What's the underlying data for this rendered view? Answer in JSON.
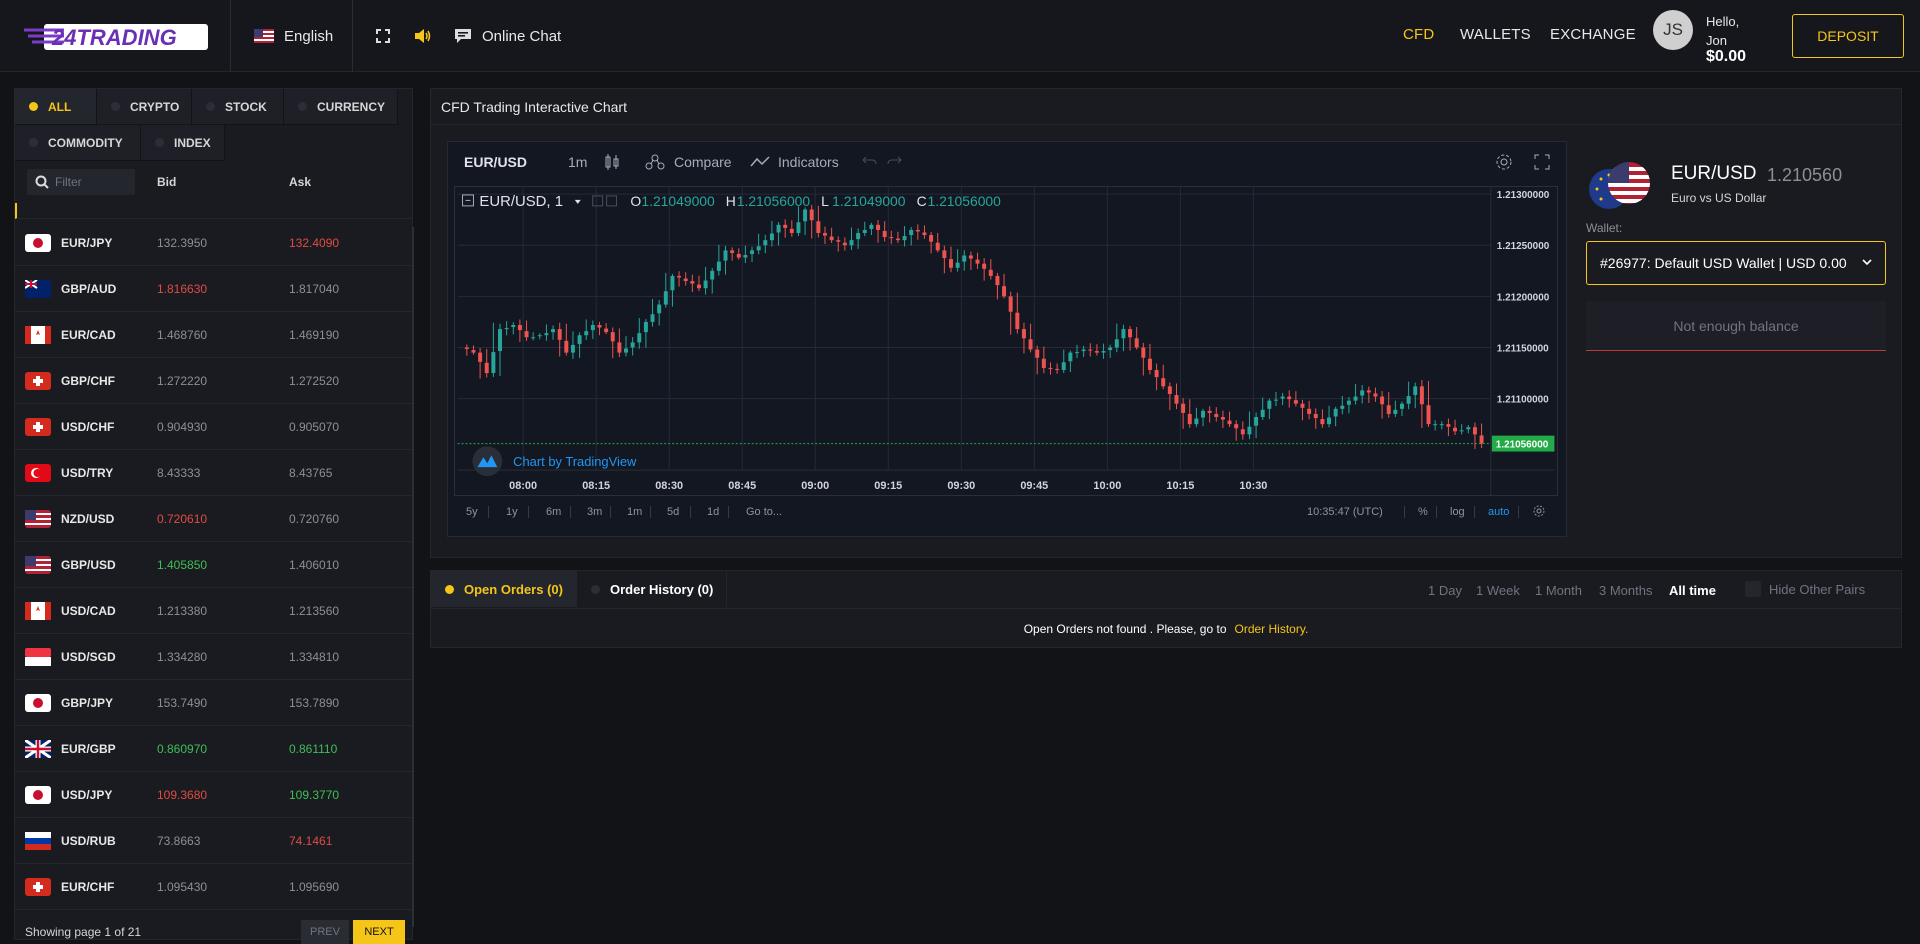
{
  "header": {
    "brand": "24TRADING",
    "language": "English",
    "chat_label": "Online Chat",
    "nav": [
      {
        "label": "CFD",
        "active": true
      },
      {
        "label": "WALLETS",
        "active": false
      },
      {
        "label": "EXCHANGE",
        "active": false
      }
    ],
    "avatar_initials": "JS",
    "greeting": "Hello,",
    "user_name": "Jon",
    "balance": "$0.00",
    "deposit_label": "DEPOSIT",
    "accent": "#f5c518"
  },
  "market": {
    "categories": [
      "ALL",
      "CRYPTO",
      "STOCK",
      "CURRENCY",
      "COMMODITY",
      "INDEX"
    ],
    "active_category": "ALL",
    "filter_placeholder": "Filter",
    "columns": {
      "bid": "Bid",
      "ask": "Ask"
    },
    "rows": [
      {
        "symbol": "EUR/JPY",
        "bid": "132.3950",
        "ask": "132.4090",
        "bid_color": "neutral",
        "ask_color": "red",
        "flag": "jp"
      },
      {
        "symbol": "GBP/AUD",
        "bid": "1.816630",
        "ask": "1.817040",
        "bid_color": "red",
        "ask_color": "neutral",
        "flag": "au"
      },
      {
        "symbol": "EUR/CAD",
        "bid": "1.468760",
        "ask": "1.469190",
        "bid_color": "neutral",
        "ask_color": "neutral",
        "flag": "ca"
      },
      {
        "symbol": "GBP/CHF",
        "bid": "1.272220",
        "ask": "1.272520",
        "bid_color": "neutral",
        "ask_color": "neutral",
        "flag": "ch"
      },
      {
        "symbol": "USD/CHF",
        "bid": "0.904930",
        "ask": "0.905070",
        "bid_color": "neutral",
        "ask_color": "neutral",
        "flag": "ch"
      },
      {
        "symbol": "USD/TRY",
        "bid": "8.43333",
        "ask": "8.43765",
        "bid_color": "neutral",
        "ask_color": "neutral",
        "flag": "tr"
      },
      {
        "symbol": "NZD/USD",
        "bid": "0.720610",
        "ask": "0.720760",
        "bid_color": "red",
        "ask_color": "neutral",
        "flag": "us"
      },
      {
        "symbol": "GBP/USD",
        "bid": "1.405850",
        "ask": "1.406010",
        "bid_color": "green",
        "ask_color": "neutral",
        "flag": "us"
      },
      {
        "symbol": "USD/CAD",
        "bid": "1.213380",
        "ask": "1.213560",
        "bid_color": "neutral",
        "ask_color": "neutral",
        "flag": "ca"
      },
      {
        "symbol": "USD/SGD",
        "bid": "1.334280",
        "ask": "1.334810",
        "bid_color": "neutral",
        "ask_color": "neutral",
        "flag": "sg"
      },
      {
        "symbol": "GBP/JPY",
        "bid": "153.7490",
        "ask": "153.7890",
        "bid_color": "neutral",
        "ask_color": "neutral",
        "flag": "jp"
      },
      {
        "symbol": "EUR/GBP",
        "bid": "0.860970",
        "ask": "0.861110",
        "bid_color": "green",
        "ask_color": "green",
        "flag": "gb"
      },
      {
        "symbol": "USD/JPY",
        "bid": "109.3680",
        "ask": "109.3770",
        "bid_color": "red",
        "ask_color": "green",
        "flag": "jp"
      },
      {
        "symbol": "USD/RUB",
        "bid": "73.8663",
        "ask": "74.1461",
        "bid_color": "neutral",
        "ask_color": "red",
        "flag": "ru"
      },
      {
        "symbol": "EUR/CHF",
        "bid": "1.095430",
        "ask": "1.095690",
        "bid_color": "neutral",
        "ask_color": "neutral",
        "flag": "ch"
      }
    ],
    "paging_text": "Showing page 1 of 21",
    "prev_label": "PREV",
    "next_label": "NEXT"
  },
  "chart_panel": {
    "title": "CFD Trading Interactive Chart",
    "toolbar": {
      "symbol": "EUR/USD",
      "interval": "1m",
      "compare": "Compare",
      "indicators": "Indicators"
    },
    "legend": {
      "symbol": "EUR/USD, 1",
      "o_label": "O",
      "o": "1.21049000",
      "h_label": "H",
      "h": "1.21056000",
      "l_label": "L",
      "l": "1.21049000",
      "c_label": "C",
      "c": "1.21056000"
    },
    "watermark": "Chart by TradingView",
    "ranges": [
      "5y",
      "1y",
      "6m",
      "3m",
      "1m",
      "5d",
      "1d"
    ],
    "goto": "Go to...",
    "clock": "10:35:47 (UTC)",
    "pct": "%",
    "log": "log",
    "auto": "auto"
  },
  "chart_data": {
    "type": "candlestick",
    "series_name": "EUR/USD, 1",
    "x_tick_labels": [
      "08:00",
      "08:15",
      "08:30",
      "08:45",
      "09:00",
      "09:15",
      "09:30",
      "09:45",
      "10:00",
      "10:15",
      "10:30"
    ],
    "y_tick_labels": [
      "1.21300000",
      "1.21250000",
      "1.21200000",
      "1.21150000",
      "1.21100000"
    ],
    "ylim": [
      1.2103,
      1.21307
    ],
    "last_price": "1.21056000",
    "close_path": [
      1.21145,
      1.21125,
      1.21168,
      1.21172,
      1.2116,
      1.21162,
      1.21168,
      1.21145,
      1.21162,
      1.21172,
      1.21165,
      1.21145,
      1.21155,
      1.21175,
      1.21192,
      1.2122,
      1.21215,
      1.21208,
      1.21225,
      1.21245,
      1.21238,
      1.21245,
      1.21255,
      1.2127,
      1.21262,
      1.21285,
      1.21262,
      1.21255,
      1.2125,
      1.21262,
      1.2127,
      1.21258,
      1.21255,
      1.21265,
      1.2126,
      1.21245,
      1.21228,
      1.2124,
      1.21232,
      1.2122,
      1.212,
      1.21168,
      1.21148,
      1.2113,
      1.21128,
      1.21145,
      1.21148,
      1.21145,
      1.2115,
      1.21168,
      1.2115,
      1.21128,
      1.21112,
      1.21095,
      1.21075,
      1.21088,
      1.21082,
      1.21075,
      1.21065,
      1.21082,
      1.21098,
      1.21102,
      1.21095,
      1.21085,
      1.21075,
      1.2109,
      1.21098,
      1.21108,
      1.21102,
      1.21085,
      1.21095,
      1.21112,
      1.21075,
      1.21075,
      1.21068,
      1.21072,
      1.21056
    ],
    "ticker_color_up": "#26a69a",
    "ticker_color_down": "#ef5350",
    "last_price_color": "#22ab46"
  },
  "instrument": {
    "symbol": "EUR/USD",
    "price": "1.210560",
    "description": "Euro vs US Dollar",
    "wallet_label": "Wallet:",
    "wallet_value": "#26977: Default USD Wallet | USD 0.00",
    "notice": "Not enough balance"
  },
  "orders": {
    "tabs": [
      {
        "label": "Open Orders",
        "count": "(0)",
        "active": true
      },
      {
        "label": "Order History",
        "count": "(0)",
        "active": false
      }
    ],
    "ranges": [
      "1 Day",
      "1 Week",
      "1 Month",
      "3 Months",
      "All time"
    ],
    "active_range": "All time",
    "hide_pairs": "Hide Other Pairs",
    "empty_text": "Open Orders not found . Please, go to",
    "empty_link": "Order History."
  }
}
